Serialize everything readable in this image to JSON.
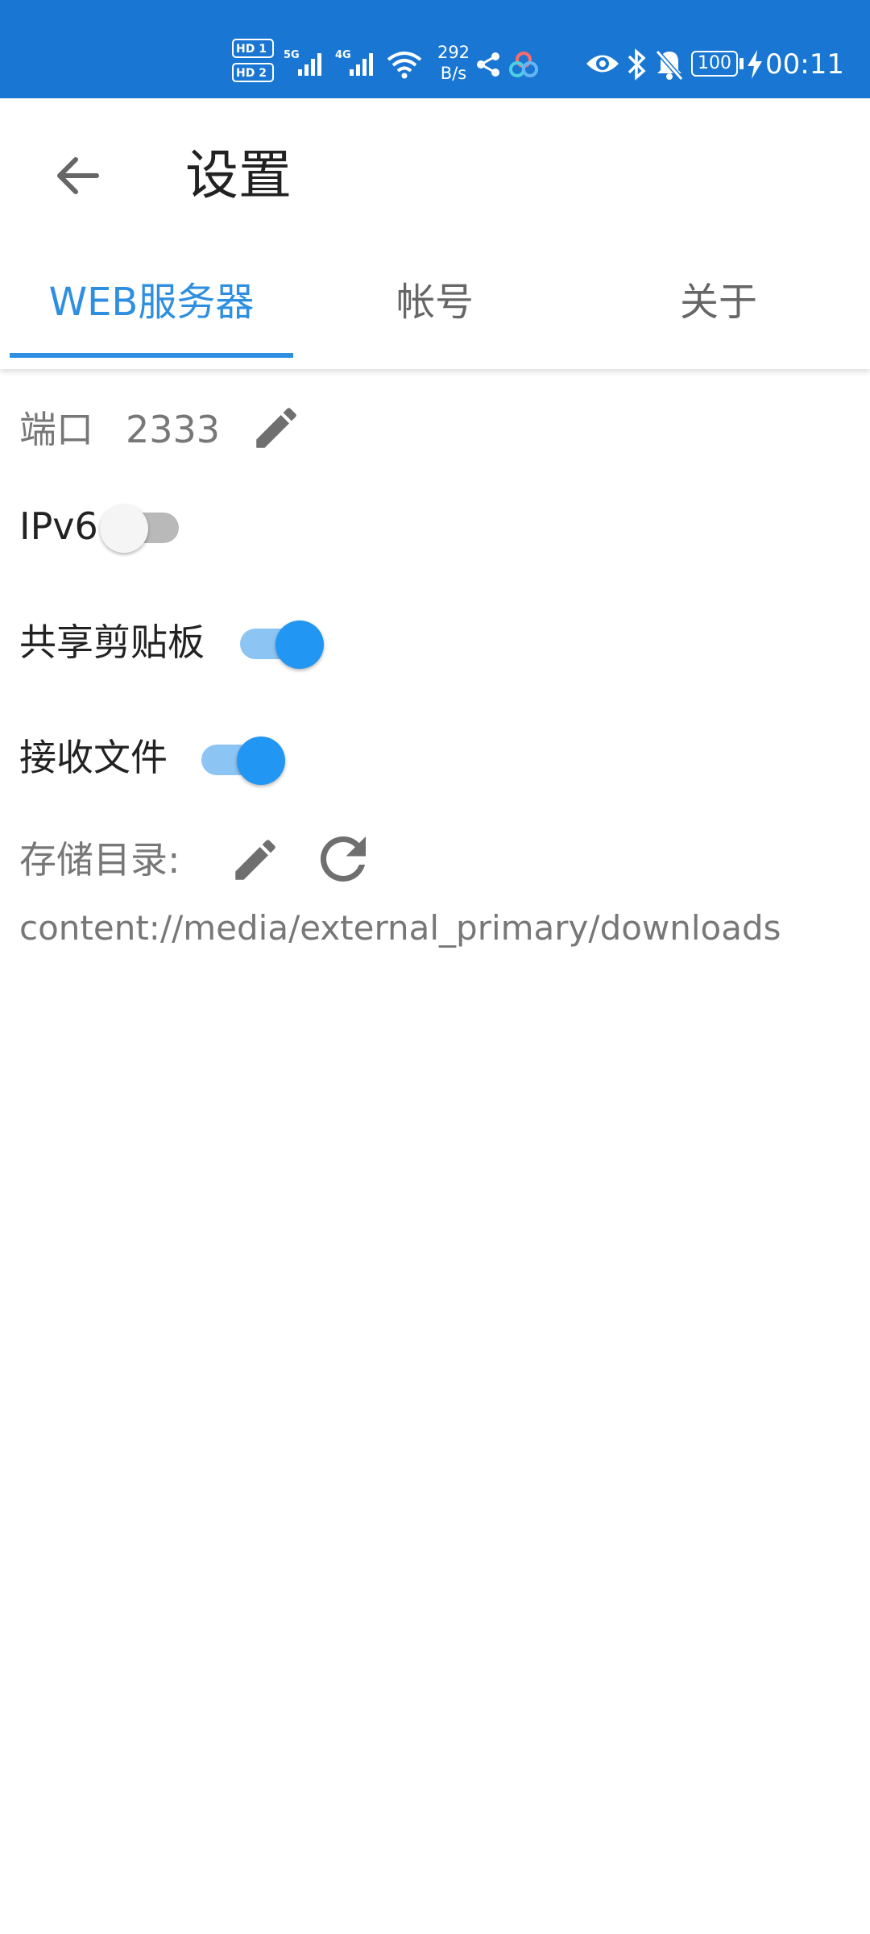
{
  "status_bar": {
    "sim1": "HD 1",
    "sim2": "HD 2",
    "net5g": "5G",
    "net4g": "4G",
    "speed_value": "292",
    "speed_unit": "B/s",
    "battery": "100",
    "time": "00:11",
    "icons": [
      "signal-5g-icon",
      "signal-4g-icon",
      "wifi-icon",
      "share-icon",
      "app-icon",
      "eye-icon",
      "bluetooth-icon",
      "bell-off-icon",
      "battery-icon",
      "charging-icon"
    ]
  },
  "app_bar": {
    "title": "设置"
  },
  "tabs": [
    {
      "label": "WEB服务器",
      "active": true
    },
    {
      "label": "帐号",
      "active": false
    },
    {
      "label": "关于",
      "active": false
    }
  ],
  "settings": {
    "port_label": "端口",
    "port_value": "2333",
    "ipv6_label": "IPv6",
    "ipv6_enabled": false,
    "clipboard_label": "共享剪贴板",
    "clipboard_enabled": true,
    "receive_label": "接收文件",
    "receive_enabled": true,
    "storage_label": "存储目录:",
    "storage_path": "content://media/external_primary/downloads"
  },
  "colors": {
    "status_bar": "#1976D2",
    "accent": "#2196F3",
    "tab_active": "#2E8FE0"
  }
}
